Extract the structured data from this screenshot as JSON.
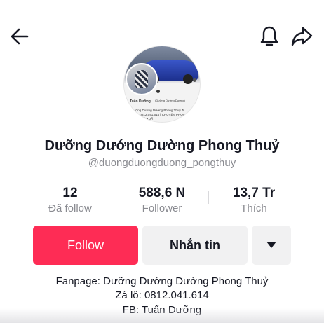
{
  "header": {
    "back_icon": "arrow-left-icon",
    "bell_icon": "bell-icon",
    "share_icon": "share-icon"
  },
  "avatar": {
    "mini_title": "Tuấn Dưỡng",
    "mini_subtitle": "(Dưỡng Dướng Dường)",
    "mini_line1": "Dưỡng Dướng Dường Phong Thuỷ đi",
    "mini_line2": "Zá lô: 0812.041.614 | CHUYÊN PHONG",
    "mini_line3": "NỮ - NHÀ XUẤT"
  },
  "profile": {
    "name": "Dưỡng Dướng Dường Phong Thuỷ",
    "handle": "@duongduongduong_pongthuy"
  },
  "stats": {
    "following_count": "12",
    "following_label": "Đã follow",
    "followers_count": "588,6 N",
    "followers_label": "Follower",
    "likes_count": "13,7 Tr",
    "likes_label": "Thích"
  },
  "actions": {
    "follow_label": "Follow",
    "message_label": "Nhắn tin",
    "more_icon": "caret-down-icon"
  },
  "bio": {
    "line1": "Fanpage: Dưỡng Dướng Dường Phong Thuỷ",
    "line2": "Zá lô: 0812.041.614",
    "line3": "FB: Tuấn Dưỡng"
  },
  "colors": {
    "accent": "#fe2c55",
    "secondary_button": "#f1f1f2",
    "muted_text": "#8a8b91"
  }
}
